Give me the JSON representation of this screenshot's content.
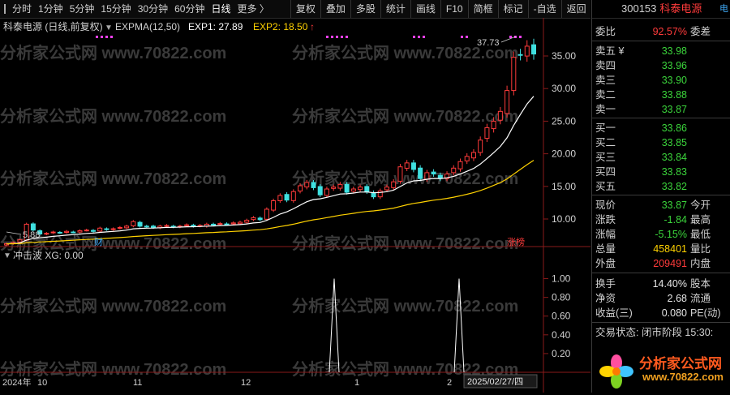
{
  "toolbar": {
    "periods": [
      "分时",
      "1分钟",
      "5分钟",
      "15分钟",
      "30分钟",
      "60分钟",
      "日线",
      "更多 〉"
    ],
    "active_period": "日线",
    "tools": [
      "复权",
      "叠加",
      "多股",
      "统计",
      "画线",
      "F10",
      "简框",
      "标记",
      "-自选",
      "返回"
    ]
  },
  "chart": {
    "stock_label": "科泰电源 (日线,前复权)",
    "indicator": "EXPMA(12,50)",
    "exp1_label": "EXP1: 27.89",
    "exp2_label": "EXP2: 18.50",
    "arrow_up": "↑",
    "y_axis": [
      "35.00",
      "30.00",
      "25.00",
      "20.00",
      "15.00",
      "10.00"
    ],
    "max_price_label": "37.73",
    "min_price_label": "5.88",
    "cai_label": "财",
    "zhangbang_label": "涨榜",
    "sub_title": "冲击波  XG: 0.00",
    "sub_y_axis": [
      "1.00",
      "0.80",
      "0.60",
      "0.40",
      "0.20"
    ],
    "x_axis": [
      "2024年",
      "10",
      "11",
      "12",
      "1",
      "2",
      "2025/02/27/四"
    ],
    "watermark": "分析家公式网 www.70822.com"
  },
  "chart_data": {
    "type": "candlestick",
    "title": "科泰电源 (日线,前复权)",
    "indicator": "EXPMA(12,50)",
    "y_range": [
      5,
      39
    ],
    "max_price": 37.73,
    "min_price": 5.88,
    "exp1_last": 27.89,
    "exp2_last": 18.5,
    "close_series": [
      6.2,
      6.4,
      6.8,
      9.2,
      8.3,
      7.7,
      7.8,
      8.0,
      7.9,
      8.1,
      8.0,
      8.2,
      8.3,
      8.1,
      8.6,
      8.4,
      8.5,
      8.7,
      8.9,
      9.6,
      8.9,
      8.8,
      8.7,
      8.9,
      9.0,
      8.8,
      8.9,
      9.1,
      8.9,
      9.0,
      9.2,
      9.1,
      9.3,
      9.2,
      9.4,
      9.5,
      9.8,
      10.2,
      9.9,
      11.5,
      12.8,
      13.6,
      12.9,
      14.2,
      15.1,
      15.6,
      14.8,
      13.7,
      14.6,
      14.9,
      15.3,
      14.1,
      14.6,
      14.9,
      14.2,
      13.4,
      14.3,
      14.9,
      15.7,
      18.0,
      18.6,
      17.6,
      16.2,
      17.1,
      16.9,
      16.2,
      16.9,
      17.8,
      18.8,
      19.6,
      20.2,
      22.1,
      24.0,
      25.0,
      26.5,
      29.7,
      34.8,
      35.2,
      36.5,
      35.3
    ],
    "signal_series": {
      "name": "XG",
      "values_at_peaks": [
        1.0,
        1.0
      ]
    },
    "sub_range": [
      0,
      1.1
    ],
    "x_labels": [
      "2024年",
      "10",
      "11",
      "12",
      "1",
      "2"
    ]
  },
  "quote": {
    "code": "300153",
    "name": "科泰电源",
    "tag": "电",
    "weibi_label": "委比",
    "weibi_value": "92.57%",
    "weicha_label": "委差",
    "asks": [
      {
        "label": "卖五 ¥",
        "price": "33.98"
      },
      {
        "label": "卖四",
        "price": "33.96"
      },
      {
        "label": "卖三",
        "price": "33.90"
      },
      {
        "label": "卖二",
        "price": "33.88"
      },
      {
        "label": "卖一",
        "price": "33.87"
      }
    ],
    "bids": [
      {
        "label": "买一",
        "price": "33.86"
      },
      {
        "label": "买二",
        "price": "33.85"
      },
      {
        "label": "买三",
        "price": "33.84"
      },
      {
        "label": "买四",
        "price": "33.83"
      },
      {
        "label": "买五",
        "price": "33.82"
      }
    ],
    "stats": [
      {
        "label": "现价",
        "value": "33.87",
        "right": "今开",
        "color": "green"
      },
      {
        "label": "涨跌",
        "value": "-1.84",
        "right": "最高",
        "color": "green"
      },
      {
        "label": "涨幅",
        "value": "-5.15%",
        "right": "最低",
        "color": "green"
      },
      {
        "label": "总量",
        "value": "458401",
        "right": "量比",
        "color": "yellow"
      },
      {
        "label": "外盘",
        "value": "209491",
        "right": "内盘",
        "color": "red"
      }
    ],
    "stats2": [
      {
        "label": "换手",
        "value": "14.40%",
        "right": "股本"
      },
      {
        "label": "净资",
        "value": "2.68",
        "right": "流通"
      },
      {
        "label": "收益(三)",
        "value": "0.080",
        "right": "PE(动)"
      }
    ],
    "status_label": "交易状态: 闭市阶段 15:30:",
    "logo_text": "分析家公式网",
    "logo_url": "www.70822.com"
  }
}
